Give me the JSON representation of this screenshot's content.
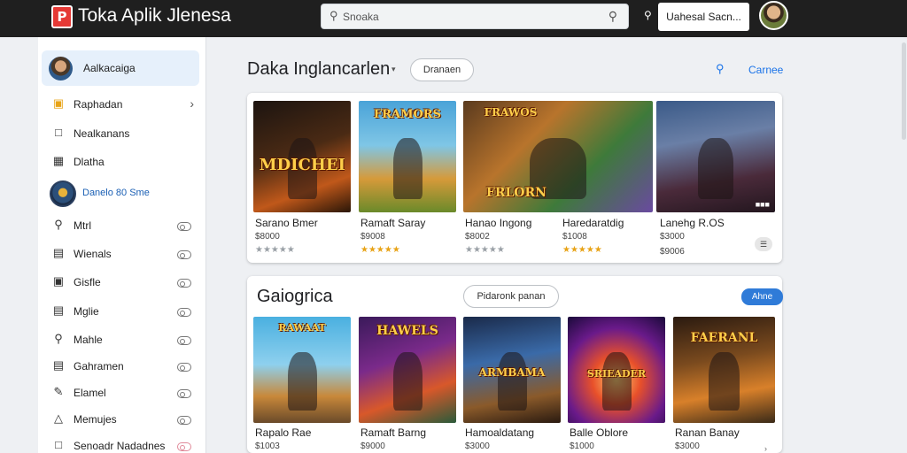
{
  "header": {
    "logo_letter": "P",
    "title": "Toka Aplik Jlenesa",
    "search_value": "Snoaka",
    "login_label": "Uahesal Sacn..."
  },
  "sidebar": {
    "account_label": "Aalkacaiga",
    "items": [
      {
        "label": "Raphadan",
        "icon": "bag-icon"
      },
      {
        "label": "Nealkanans",
        "icon": "square-icon"
      },
      {
        "label": "Dlatha",
        "icon": "grid-icon"
      }
    ],
    "feature_label": "Danelo 80 Sme",
    "toggle_items": [
      {
        "label": "Mtrl",
        "icon": "search-icon"
      },
      {
        "label": "Wienals",
        "icon": "chart-icon"
      },
      {
        "label": "Gisfle",
        "icon": "bag-icon"
      },
      {
        "label": "Mglie",
        "icon": "chart-icon"
      },
      {
        "label": "Mahle",
        "icon": "search-icon"
      },
      {
        "label": "Gahramen",
        "icon": "chart-icon"
      },
      {
        "label": "Elamel",
        "icon": "pen-icon"
      },
      {
        "label": "Memujes",
        "icon": "gamepad-icon"
      },
      {
        "label": "Senoadr Nadadnes",
        "icon": "square-icon"
      }
    ]
  },
  "section1": {
    "title": "Daka Inglancarlen",
    "filter_pill": "Dranaen",
    "more_label": "Carnee",
    "games": [
      {
        "name": "Sarano Bmer",
        "price": "$8000",
        "rating": "grey",
        "art_text": "MDICHED"
      },
      {
        "name": "Ramaft Saray",
        "price": "$9008",
        "rating": "gold",
        "art_text": "FRAMORS"
      },
      {
        "name": "Hanao Ingong",
        "price": "$8002",
        "rating": "grey",
        "art_text": "FRLORN"
      },
      {
        "name": "Haredaratdig",
        "price": "$1008",
        "rating": "gold",
        "art_text": ""
      },
      {
        "name": "Lanehg R.OS",
        "price": "$3000",
        "price2": "$9006",
        "rating": "none",
        "art_text": ""
      }
    ]
  },
  "section2": {
    "title": "Gaiogrica",
    "filter_pill": "Pidaronk panan",
    "button_label": "Ahne",
    "games": [
      {
        "name": "Rapalo Rae",
        "price": "$1003",
        "art_text": "RAWAAT"
      },
      {
        "name": "Ramaft Barng",
        "price": "$9000",
        "art_text": "HAWELS"
      },
      {
        "name": "Hamoaldatang",
        "price": "$3000",
        "art_text": "ARMBAMA"
      },
      {
        "name": "Balle Oblore",
        "price": "$1000",
        "art_text": "SRIEADER"
      },
      {
        "name": "Ranan Banay",
        "price": "$3000",
        "art_text": "FAERANL"
      }
    ]
  },
  "colors": {
    "topbar": "#1f1f1f",
    "accent": "#1a73e8",
    "star_gold": "#e8a317",
    "star_grey": "#9aa0a6"
  }
}
